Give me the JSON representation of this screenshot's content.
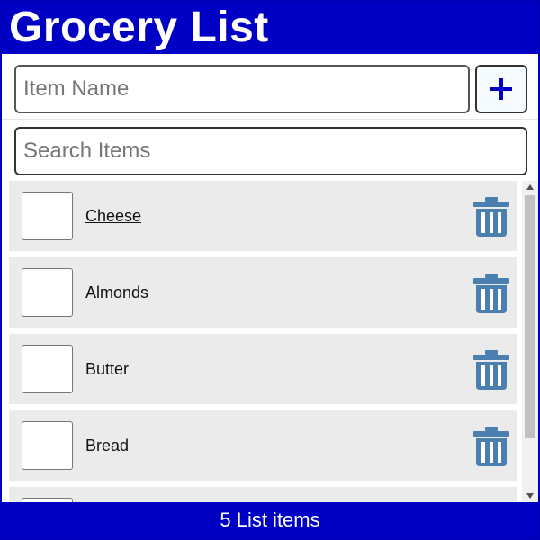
{
  "header": {
    "title": "Grocery List"
  },
  "add_form": {
    "placeholder": "Item Name",
    "add_icon": "plus-icon",
    "add_label": "+"
  },
  "search": {
    "placeholder": "Search Items"
  },
  "items": [
    {
      "label": "Cheese",
      "checked": false
    },
    {
      "label": "Almonds",
      "checked": false
    },
    {
      "label": "Butter",
      "checked": false
    },
    {
      "label": "Bread",
      "checked": false
    },
    {
      "label": "",
      "checked": false
    }
  ],
  "footer": {
    "count_text": "5 List items"
  },
  "colors": {
    "brand": "#0000c4",
    "trash": "#4a7fb0",
    "row_bg": "#ebebeb"
  },
  "icons": {
    "delete": "trash-icon",
    "scroll_up": "chevron-up-icon",
    "scroll_down": "chevron-down-icon"
  }
}
